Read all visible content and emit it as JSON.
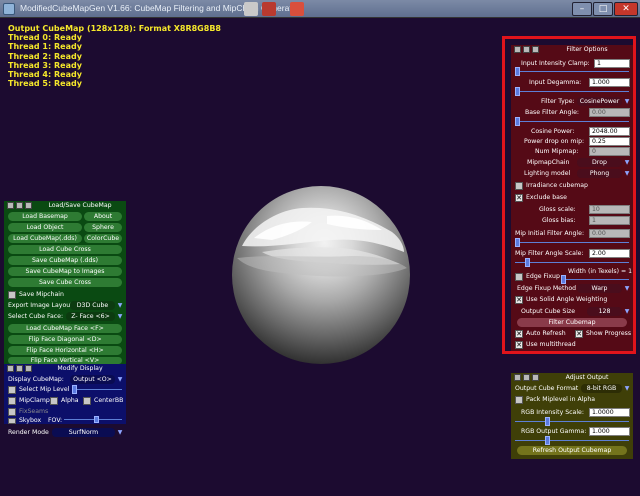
{
  "window": {
    "title": "ModifiedCubeMapGen V1.66: CubeMap Filtering and MipChain Generator",
    "minimize_icon": "minimize-icon",
    "maximize_icon": "maximize-icon",
    "close_icon": "close-icon"
  },
  "status": {
    "lines": [
      "Output CubeMap (128x128): Format X8R8G8B8",
      "Thread 0: Ready",
      "Thread 1: Ready",
      "Thread 2: Ready",
      "Thread 3: Ready",
      "Thread 4: Ready",
      "Thread 5: Ready"
    ],
    "color": "#f5e72b"
  },
  "filter_panel": {
    "caption": "Filter Options",
    "input_intensity_clamp_label": "Input Intensity Clamp:",
    "input_intensity_clamp_value": "1",
    "input_degamma_label": "Input Degamma:",
    "input_degamma_value": "1.000",
    "filter_type_label": "Filter Type:",
    "filter_type_value": "CosinePower",
    "base_filter_angle_label": "Base Filter Angle:",
    "base_filter_angle_value": "0.00",
    "cosine_power_label": "Cosine Power:",
    "cosine_power_value": "2048.00",
    "power_drop_label": "Power drop on mip:",
    "power_drop_value": "0.25",
    "num_mipmap_label": "Num Mipmap:",
    "num_mipmap_value": "0",
    "mipmap_chain_label": "MipmapChain",
    "mipmap_chain_value": "Drop",
    "lighting_model_label": "Lighting model",
    "lighting_model_value": "Phong",
    "irradiance_label": "Irradiance cubemap",
    "exclude_base_label": "Exclude base",
    "gloss_scale_label": "Gloss scale:",
    "gloss_scale_value": "10",
    "gloss_bias_label": "Gloss bias:",
    "gloss_bias_value": "1",
    "mip_initial_label": "Mip Initial Filter Angle:",
    "mip_initial_value": "0.00",
    "mip_scale_label": "Mip Filter Angle Scale:",
    "mip_scale_value": "2.00",
    "edge_fixup_label": "Edge Fixup",
    "width_texels_label": "Width (in Texels) = 1",
    "edge_fixup_method_label": "Edge Fixup Method",
    "edge_fixup_method_value": "Warp",
    "solid_angle_label": "Use Solid Angle Weighting",
    "output_cube_size_label": "Output Cube Size",
    "output_cube_size_value": "128",
    "filter_cubemap_button": "Filter Cubemap",
    "auto_refresh_label": "Auto Refresh",
    "show_progress_label": "Show Progress",
    "multithread_label": "Use multithread"
  },
  "loadsave_panel": {
    "caption": "Load/Save CubeMap",
    "load_basemap": "Load Basemap",
    "about": "About",
    "load_object": "Load Object",
    "sphere": "Sphere",
    "load_cubemap_dds": "Load CubeMap(.dds)",
    "colorcube": "ColorCube",
    "load_cube_cross": "Load Cube Cross",
    "save_cubemap_dds": "Save CubeMap (.dds)",
    "save_cubemap_images": "Save CubeMap to Images",
    "save_cube_cross": "Save Cube Cross",
    "save_mipchain_label": "Save Mipchain",
    "export_layout_label": "Export Image Layout:",
    "export_layout_value": "D3D Cube",
    "select_face_label": "Select Cube Face:",
    "select_face_value": "Z- Face <6>",
    "load_face": "Load CubeMap Face <F>",
    "flip_diagonal": "Flip Face Diagonal <D>",
    "flip_horizontal": "Flip Face Horizontal <H>",
    "flip_vertical": "Flip Face Vertical <V>"
  },
  "display_panel": {
    "caption": "Modify Display",
    "display_cubemap_label": "Display CubeMap:",
    "display_cubemap_value": "Output <O>",
    "select_mip_label": "Select Mip Level",
    "mipclamp_label": "MipClamp",
    "alpha_label": "Alpha",
    "centerbb_label": "CenterBB",
    "fixseams_label": "FixSeams",
    "skybox_label": "Skybox",
    "fov_label": "FOV:",
    "render_mode_label": "Render Mode",
    "render_mode_value": "SurfNorm"
  },
  "output_panel": {
    "caption": "Adjust Output",
    "output_format_label": "Output Cube Format",
    "output_format_value": "8-bit RGB",
    "pack_mip_label": "Pack Miplevel in Alpha",
    "rgb_scale_label": "RGB Intensity Scale:",
    "rgb_scale_value": "1.0000",
    "rgb_gamma_label": "RGB Output Gamma:",
    "rgb_gamma_value": "1.000",
    "refresh_button": "Refresh Output Cubemap"
  },
  "colors": {
    "background": "#1c0b30",
    "filter_panel": "#550a16",
    "highlight_frame": "#e0141b",
    "loadsave_panel": "#0a4a12",
    "display_panel": "#0c0f6a",
    "output_panel": "#3f3f08"
  }
}
